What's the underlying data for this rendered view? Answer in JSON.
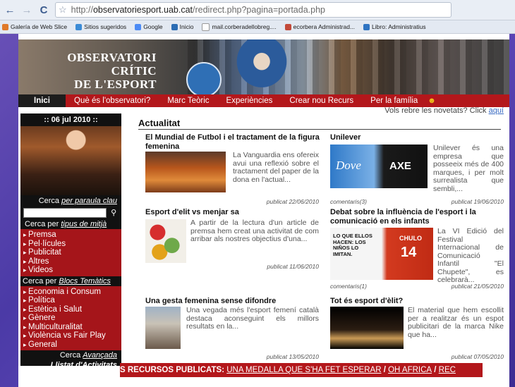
{
  "browser": {
    "url_prefix": "http://",
    "url_domain": "observatoriesport.uab.cat",
    "url_path": "/redirect.php?pagina=portada.php",
    "bookmarks": [
      {
        "label": "Galería de Web Slice",
        "color": "#e07a2a"
      },
      {
        "label": "Sitios sugeridos",
        "color": "#3b8bd6"
      },
      {
        "label": "Google",
        "color": "#4c8bf5"
      },
      {
        "label": "Inicio",
        "color": "#2c6db4"
      },
      {
        "label": "mail.corberadellobreg....",
        "color": "#d4d8df"
      },
      {
        "label": "ecorbera Administrad...",
        "color": "#c34a3a"
      },
      {
        "label": "Libro: Administratius",
        "color": "#2f74c2"
      }
    ]
  },
  "site": {
    "title_lines": [
      "OBSERVATORI",
      "CRÍTIC",
      "DE L'ESPORT"
    ],
    "menu": [
      "Inici",
      "Què és l'observatori?",
      "Marc Teòric",
      "Experiències",
      "Crear nou Recurs",
      "Per la família"
    ],
    "subscribe_text": "Vols rebre les novetats? Click ",
    "subscribe_link": "aquí"
  },
  "sidebar": {
    "date": ":: 06 jul 2010 ::",
    "cerca_paraula_prefix": "Cerca ",
    "cerca_paraula_link": "per paraula clau",
    "cerca_tipus_prefix": "Cerca per ",
    "cerca_tipus_link": "tipus de mitjà",
    "tipus": [
      "Premsa",
      "Pel·lícules",
      "Publicitat",
      "Altres",
      "Videos"
    ],
    "cerca_blocs_prefix": "Cerca per ",
    "cerca_blocs_link": "Blocs Temàtics",
    "blocs": [
      "Economia i Consum",
      "Política",
      "Estètica i Salut",
      "Gènere",
      "Multiculturalitat",
      "Violència vs Fair Play",
      "General"
    ],
    "cerca_avancada_prefix": "Cerca ",
    "cerca_avancada_link": "Avançada",
    "llistat_prefix": "Llistat d'",
    "llistat_link": "Activitats"
  },
  "main": {
    "heading": "Actualitat",
    "articles": [
      {
        "title": "El Mundial de Futbol i el tractament de la figura femenina",
        "text": "La Vanguardia ens ofereix avui una reflexió sobre el tractament del paper de la dona en l'actual...",
        "comments": "",
        "published": "publicat 22/06/2010"
      },
      {
        "title": "Unilever",
        "text": "Unilever és una empresa que posseeix més de 400 marques, i per molt surrealista que sembli,...",
        "comments": "comentaris(3)",
        "published": "publicat 19/06/2010"
      },
      {
        "title": "Esport d'elit vs menjar sa",
        "text": "A partir de la lectura d'un article de premsa hem creat una activitat de com arribar als nostres objectius d'una...",
        "comments": "",
        "published": "publicat 11/06/2010"
      },
      {
        "title": "Debat sobre la influència de l'esport i la comunicació en els infants",
        "text": "La VI Edició del Festival Internacional de Comunicació Infantil \"El Chupete\", es celebrarà...",
        "comments": "comentaris(1)",
        "published": "publicat 21/05/2010"
      },
      {
        "title": "Una gesta femenina sense difondre",
        "text": "Una vegada més l'esport femení català destaca aconseguint els millors resultats en la...",
        "comments": "",
        "published": "publicat 13/05/2010"
      },
      {
        "title": "Tot és esport d'èlit?",
        "text": "El material que hem escollit per a realitzar és un espot publicitari de la marca Nike que ha...",
        "comments": "",
        "published": "publicat 07/05/2010"
      }
    ],
    "image_text": {
      "dove": "Dove",
      "axe": "AXE",
      "chulo": "CHULO",
      "number": "14",
      "ellos": "LO QUE ELLOS HACEN: LOS NIÑOS LO IMITAN."
    }
  },
  "ticker": {
    "label": "S RECURSOS PUBLICATS: ",
    "link1": "UNA MEDALLA QUE S'HA FET ESPERAR",
    "sep": " / ",
    "link2": "OH AFRICA",
    "link3": "REC"
  }
}
